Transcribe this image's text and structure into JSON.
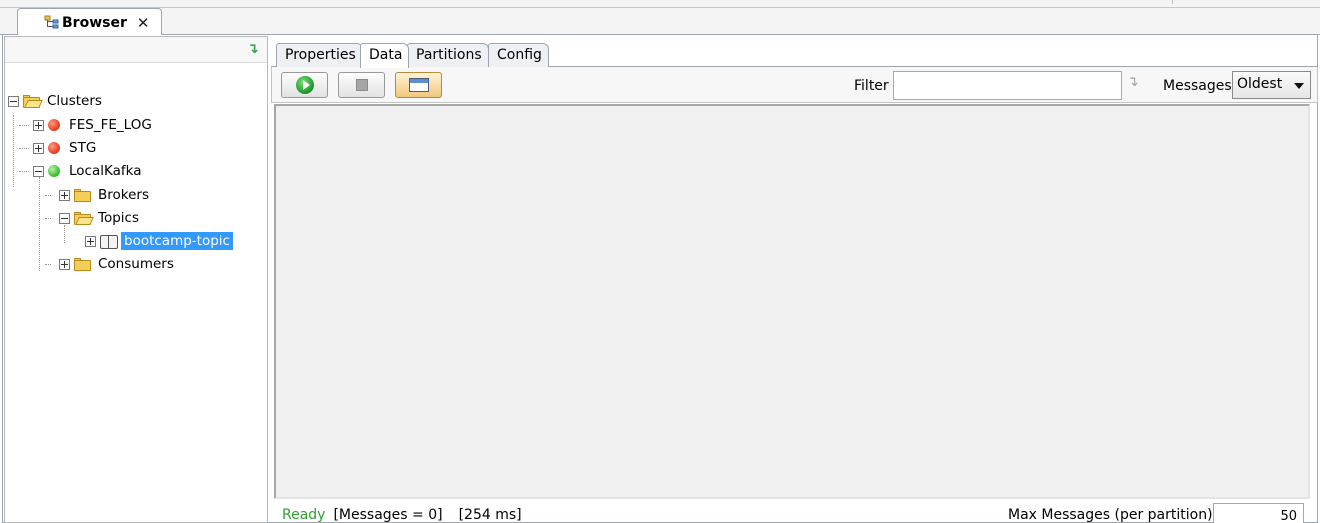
{
  "view_tab": {
    "label": "Browser",
    "close": "✕"
  },
  "tree": {
    "root": "Clusters",
    "clusters": [
      {
        "label": "FES_FE_LOG",
        "status": "red"
      },
      {
        "label": "STG",
        "status": "red"
      },
      {
        "label": "LocalKafka",
        "status": "green"
      }
    ],
    "local_children": {
      "brokers": "Brokers",
      "topics": "Topics",
      "topic_item": "bootcamp-topic",
      "consumers": "Consumers"
    }
  },
  "subtabs": [
    "Properties",
    "Data",
    "Partitions",
    "Config"
  ],
  "active_subtab": "Data",
  "toolbar": {
    "filter_label": "Filter",
    "filter_value": "",
    "messages_label": "Messages",
    "messages_selected": "Oldest"
  },
  "status": {
    "ready": "Ready",
    "messages": "[Messages = 0]",
    "time": "[254 ms]",
    "max_label": "Max Messages (per partition)",
    "max_value": "50"
  },
  "colors": {
    "selection": "#3399ff",
    "ready": "#2ea12e",
    "status_red": "#e8452a",
    "status_green": "#44c23a"
  }
}
